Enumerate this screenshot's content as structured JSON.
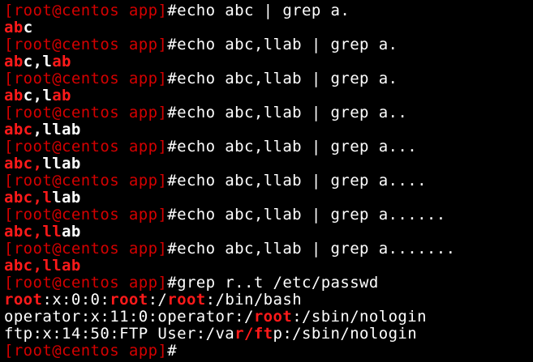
{
  "colors": {
    "background": "#000000",
    "prompt_red": "#d40000",
    "match_red": "#ff1a1a",
    "text_white": "#ffffff"
  },
  "terminal": {
    "lines": [
      {
        "kind": "prompt",
        "segments": [
          {
            "text": "[root@centos app]",
            "style": "red"
          },
          {
            "text": "#echo abc | grep a.",
            "style": "white"
          }
        ]
      },
      {
        "kind": "output",
        "segments": [
          {
            "text": "ab",
            "style": "red-bold"
          },
          {
            "text": "c",
            "style": "white-bold"
          }
        ]
      },
      {
        "kind": "prompt",
        "segments": [
          {
            "text": "[root@centos app]",
            "style": "red"
          },
          {
            "text": "#echo abc,llab | grep a.",
            "style": "white"
          }
        ]
      },
      {
        "kind": "output",
        "segments": [
          {
            "text": "ab",
            "style": "red-bold"
          },
          {
            "text": "c,l",
            "style": "white-bold"
          },
          {
            "text": "ab",
            "style": "red-bold"
          }
        ]
      },
      {
        "kind": "prompt",
        "segments": [
          {
            "text": "[root@centos app]",
            "style": "red"
          },
          {
            "text": "#echo abc,llab | grep a.",
            "style": "white"
          }
        ]
      },
      {
        "kind": "output",
        "segments": [
          {
            "text": "ab",
            "style": "red-bold"
          },
          {
            "text": "c,l",
            "style": "white-bold"
          },
          {
            "text": "ab",
            "style": "red-bold"
          }
        ]
      },
      {
        "kind": "prompt",
        "segments": [
          {
            "text": "[root@centos app]",
            "style": "red"
          },
          {
            "text": "#echo abc,llab | grep a..",
            "style": "white"
          }
        ]
      },
      {
        "kind": "output",
        "segments": [
          {
            "text": "abc",
            "style": "red-bold"
          },
          {
            "text": ",llab",
            "style": "white-bold"
          }
        ]
      },
      {
        "kind": "prompt",
        "segments": [
          {
            "text": "[root@centos app]",
            "style": "red"
          },
          {
            "text": "#echo abc,llab | grep a...",
            "style": "white"
          }
        ]
      },
      {
        "kind": "output",
        "segments": [
          {
            "text": "abc,",
            "style": "red-bold"
          },
          {
            "text": "llab",
            "style": "white-bold"
          }
        ]
      },
      {
        "kind": "prompt",
        "segments": [
          {
            "text": "[root@centos app]",
            "style": "red"
          },
          {
            "text": "#echo abc,llab | grep a....",
            "style": "white"
          }
        ]
      },
      {
        "kind": "output",
        "segments": [
          {
            "text": "abc,l",
            "style": "red-bold"
          },
          {
            "text": "lab",
            "style": "white-bold"
          }
        ]
      },
      {
        "kind": "prompt",
        "segments": [
          {
            "text": "[root@centos app]",
            "style": "red"
          },
          {
            "text": "#echo abc,llab | grep a......",
            "style": "white"
          }
        ]
      },
      {
        "kind": "output",
        "segments": [
          {
            "text": "abc,ll",
            "style": "red-bold"
          },
          {
            "text": "ab",
            "style": "white-bold"
          }
        ]
      },
      {
        "kind": "prompt",
        "segments": [
          {
            "text": "[root@centos app]",
            "style": "red"
          },
          {
            "text": "#echo abc,llab | grep a.......",
            "style": "white"
          }
        ]
      },
      {
        "kind": "output",
        "segments": [
          {
            "text": "abc,llab",
            "style": "red-bold"
          }
        ]
      },
      {
        "kind": "prompt",
        "segments": [
          {
            "text": "[root@centos app]",
            "style": "red"
          },
          {
            "text": "#grep r..t /etc/passwd",
            "style": "white"
          }
        ]
      },
      {
        "kind": "output",
        "segments": [
          {
            "text": "root",
            "style": "red-bold"
          },
          {
            "text": ":x:0:0:",
            "style": "white"
          },
          {
            "text": "root",
            "style": "red-bold"
          },
          {
            "text": ":/",
            "style": "white"
          },
          {
            "text": "root",
            "style": "red-bold"
          },
          {
            "text": ":/bin/bash",
            "style": "white"
          }
        ]
      },
      {
        "kind": "output",
        "segments": [
          {
            "text": "operator:x:11:0:operator:/",
            "style": "white"
          },
          {
            "text": "root",
            "style": "red-bold"
          },
          {
            "text": ":/sbin/nologin",
            "style": "white"
          }
        ]
      },
      {
        "kind": "output",
        "segments": [
          {
            "text": "ftp:x:14:50:FTP User:/va",
            "style": "white"
          },
          {
            "text": "r/ft",
            "style": "red-bold"
          },
          {
            "text": "p:/sbin/nologin",
            "style": "white"
          }
        ]
      },
      {
        "kind": "prompt",
        "segments": [
          {
            "text": "[root@centos app]",
            "style": "red"
          },
          {
            "text": "#",
            "style": "white"
          }
        ]
      }
    ]
  }
}
